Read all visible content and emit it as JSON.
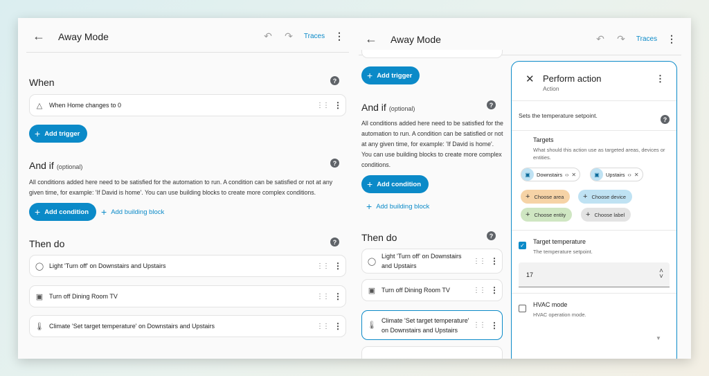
{
  "left": {
    "header": {
      "title": "Away Mode",
      "traces": "Traces"
    },
    "when": {
      "title": "When"
    },
    "trigger": {
      "label": "When Home changes to 0"
    },
    "add_trigger": "Add trigger",
    "andif": {
      "title": "And if",
      "optional": "(optional)",
      "description": "All conditions added here need to be satisfied for the automation to run. A condition can be satisfied or not at any given time, for example: 'If David is home'. You can use building blocks to create more complex conditions."
    },
    "add_condition": "Add condition",
    "add_building_block": "Add building block",
    "thendo": {
      "title": "Then do"
    },
    "actions": [
      "Light 'Turn off' on Downstairs and Upstairs",
      "Turn off Dining Room TV",
      "Climate 'Set target temperature' on Downstairs and Upstairs"
    ]
  },
  "middle": {
    "header": {
      "title": "Away Mode",
      "traces": "Traces"
    },
    "add_trigger": "Add trigger",
    "andif": {
      "title": "And if",
      "optional": "(optional)",
      "description": "All conditions added here need to be satisfied for the automation to run. A condition can be satisfied or not at any given time, for example: 'If David is home'. You can use building blocks to create more complex conditions."
    },
    "add_condition": "Add condition",
    "add_building_block": "Add building block",
    "thendo": {
      "title": "Then do"
    },
    "actions": [
      "Light 'Turn off' on Downstairs and Upstairs",
      "Turn off Dining Room TV",
      "Climate 'Set target temperature' on Downstairs and Upstairs"
    ]
  },
  "panel": {
    "title": "Perform action",
    "subtitle": "Action",
    "description": "Sets the temperature setpoint.",
    "targets": {
      "label": "Targets",
      "help": "What should this action use as targeted areas, devices or entities.",
      "chips": [
        "Downstairs",
        "Upstairs"
      ],
      "choose_area": "Choose area",
      "choose_device": "Choose device",
      "choose_entity": "Choose entity",
      "choose_label": "Choose label"
    },
    "target_temperature": {
      "label": "Target temperature",
      "help": "The temperature setpoint.",
      "value": "17",
      "checked": true
    },
    "hvac_mode": {
      "label": "HVAC mode",
      "help": "HVAC operation mode.",
      "checked": false
    }
  },
  "colors": {
    "accent": "#0b8ac8",
    "area": "#f6d3a6",
    "device": "#bfe2f3",
    "entity": "#cfe6c2",
    "label": "#e3e3e3"
  }
}
